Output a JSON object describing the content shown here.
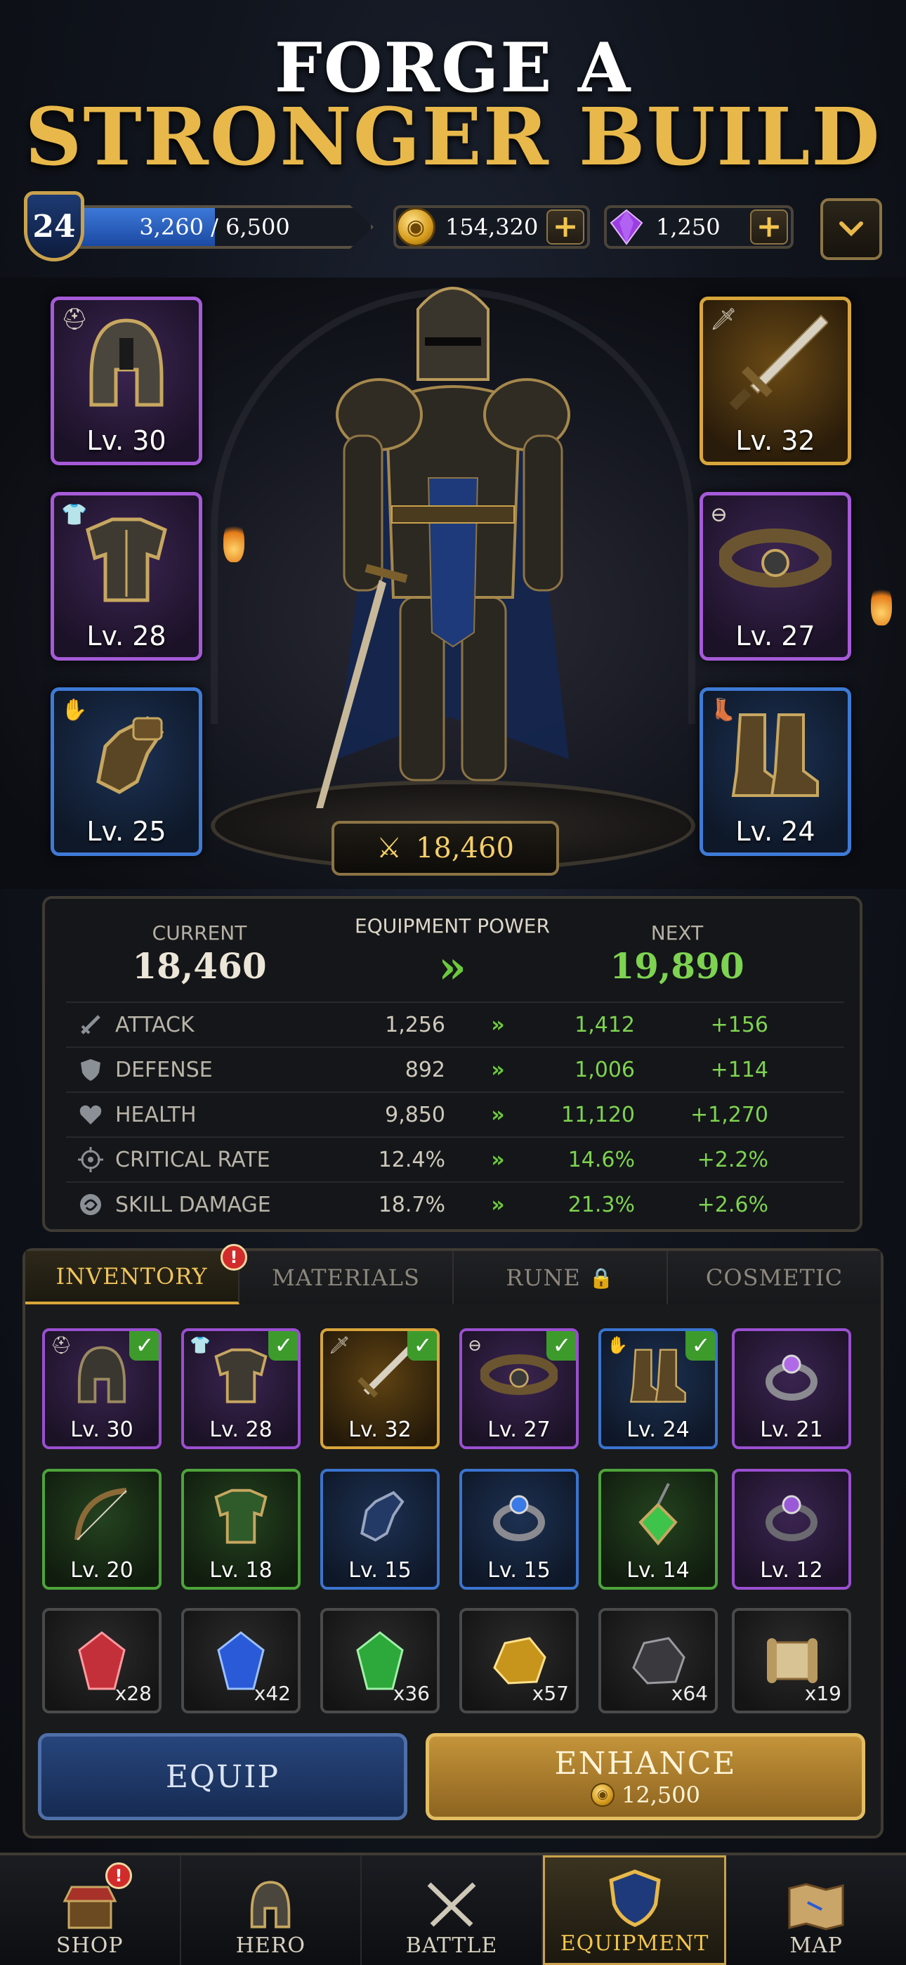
{
  "title": {
    "line1": "FORGE A",
    "line2": "STRONGER BUILD"
  },
  "top_bar": {
    "level": "24",
    "xp_text": "3,260 / 6,500",
    "xp_fraction": 0.5015,
    "gold": "154,320",
    "gems": "1,250",
    "plus_label": "+",
    "dropdown_label": "⌄"
  },
  "equipped": {
    "helmet": {
      "level": "Lv. 30",
      "rarity": "purple"
    },
    "armor": {
      "level": "Lv. 28",
      "rarity": "purple"
    },
    "gloves": {
      "level": "Lv. 25",
      "rarity": "blue"
    },
    "weapon": {
      "level": "Lv. 32",
      "rarity": "gold"
    },
    "belt": {
      "level": "Lv. 27",
      "rarity": "purple"
    },
    "boots": {
      "level": "Lv. 24",
      "rarity": "blue"
    }
  },
  "hero_power": "18,460",
  "stats": {
    "current_label": "CURRENT",
    "current_value": "18,460",
    "center_label": "EQUIPMENT POWER",
    "next_label": "NEXT",
    "next_value": "19,890",
    "arrow": "»",
    "rows": [
      {
        "name": "ATTACK",
        "current": "1,256",
        "next": "1,412",
        "diff": "+156"
      },
      {
        "name": "DEFENSE",
        "current": "892",
        "next": "1,006",
        "diff": "+114"
      },
      {
        "name": "HEALTH",
        "current": "9,850",
        "next": "11,120",
        "diff": "+1,270"
      },
      {
        "name": "CRITICAL RATE",
        "current": "12.4%",
        "next": "14.6%",
        "diff": "+2.2%"
      },
      {
        "name": "SKILL DAMAGE",
        "current": "18.7%",
        "next": "21.3%",
        "diff": "+2.6%"
      }
    ]
  },
  "tabs": {
    "inventory": "INVENTORY",
    "materials": "MATERIALS",
    "rune": "RUNE",
    "cosmetic": "COSMETIC",
    "inventory_badge": "!"
  },
  "inventory": {
    "row1": [
      "Lv. 30",
      "Lv. 28",
      "Lv. 32",
      "Lv. 27",
      "Lv. 24",
      "Lv. 21"
    ],
    "row2": [
      "Lv. 20",
      "Lv. 18",
      "Lv. 15",
      "Lv. 15",
      "Lv. 14",
      "Lv. 12"
    ],
    "materials": [
      "x28",
      "x42",
      "x36",
      "x57",
      "x64",
      "x19"
    ],
    "check": "✓"
  },
  "actions": {
    "equip": "EQUIP",
    "enhance": "ENHANCE",
    "enhance_cost": "12,500"
  },
  "nav": {
    "shop": "SHOP",
    "hero": "HERO",
    "battle": "BATTLE",
    "equipment": "EQUIPMENT",
    "map": "MAP",
    "shop_badge": "!"
  },
  "colors": {
    "gold": "#e8b84a",
    "green": "#7ed350",
    "purple_rarity": "#a65ad8",
    "blue_rarity": "#3e7ad6",
    "gold_rarity": "#d8a53a",
    "green_rarity": "#4da43a"
  }
}
